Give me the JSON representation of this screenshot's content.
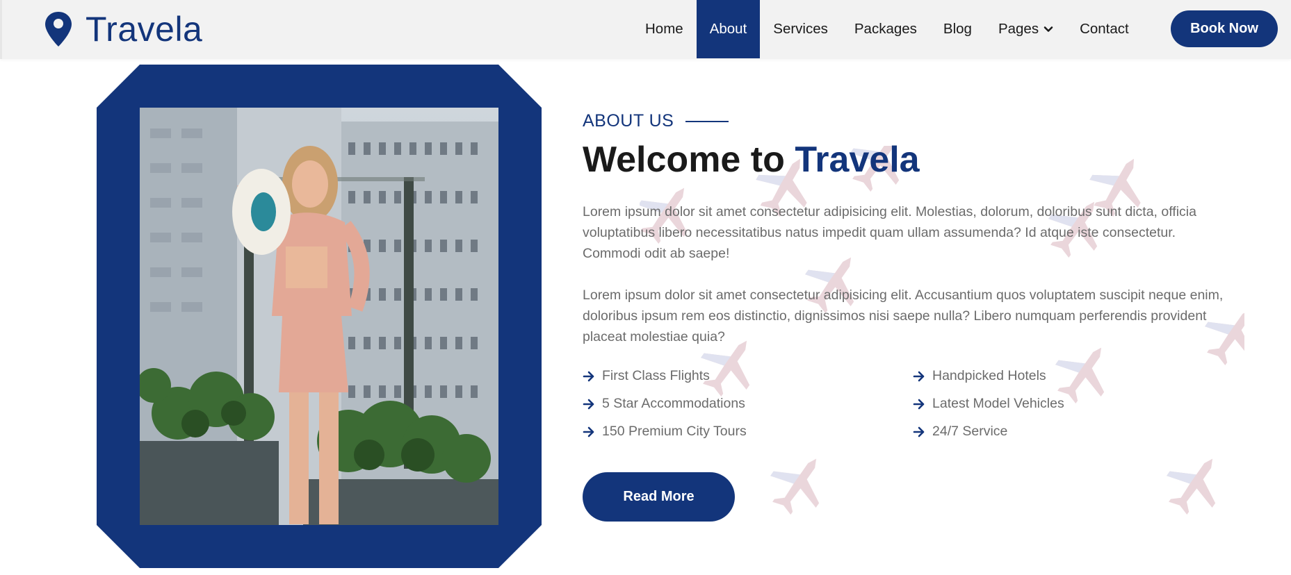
{
  "brand": {
    "name": "Travela",
    "icon": "map-pin-icon"
  },
  "nav": {
    "items": [
      {
        "label": "Home",
        "active": false
      },
      {
        "label": "About",
        "active": true
      },
      {
        "label": "Services",
        "active": false
      },
      {
        "label": "Packages",
        "active": false
      },
      {
        "label": "Blog",
        "active": false
      },
      {
        "label": "Pages",
        "active": false,
        "dropdown": true
      },
      {
        "label": "Contact",
        "active": false
      }
    ],
    "cta": "Book Now"
  },
  "about": {
    "eyebrow": "ABOUT US",
    "title_prefix": "Welcome to ",
    "title_highlight": "Travela",
    "paragraph_1": "Lorem ipsum dolor sit amet consectetur adipisicing elit. Molestias, dolorum, doloribus sunt dicta, officia voluptatibus libero necessitatibus natus impedit quam ullam assumenda? Id atque iste consectetur. Commodi odit ab saepe!",
    "paragraph_2": "Lorem ipsum dolor sit amet consectetur adipisicing elit. Accusantium quos voluptatem suscipit neque enim, doloribus ipsum rem eos distinctio, dignissimos nisi saepe nulla? Libero numquam perferendis provident placeat molestiae quia?",
    "features": [
      "First Class Flights",
      "Handpicked Hotels",
      "5 Star Accommodations",
      "Latest Model Vehicles",
      "150 Premium City Tours",
      "24/7 Service"
    ],
    "button": "Read More"
  },
  "colors": {
    "primary": "#13357b",
    "text": "#6b6b6b",
    "heading": "#1a1a1a",
    "nav_bg": "#f2f2f2"
  },
  "icons": {
    "feature_bullet": "arrow-right-icon",
    "dropdown": "chevron-down-icon",
    "background": "airplane-icon"
  }
}
